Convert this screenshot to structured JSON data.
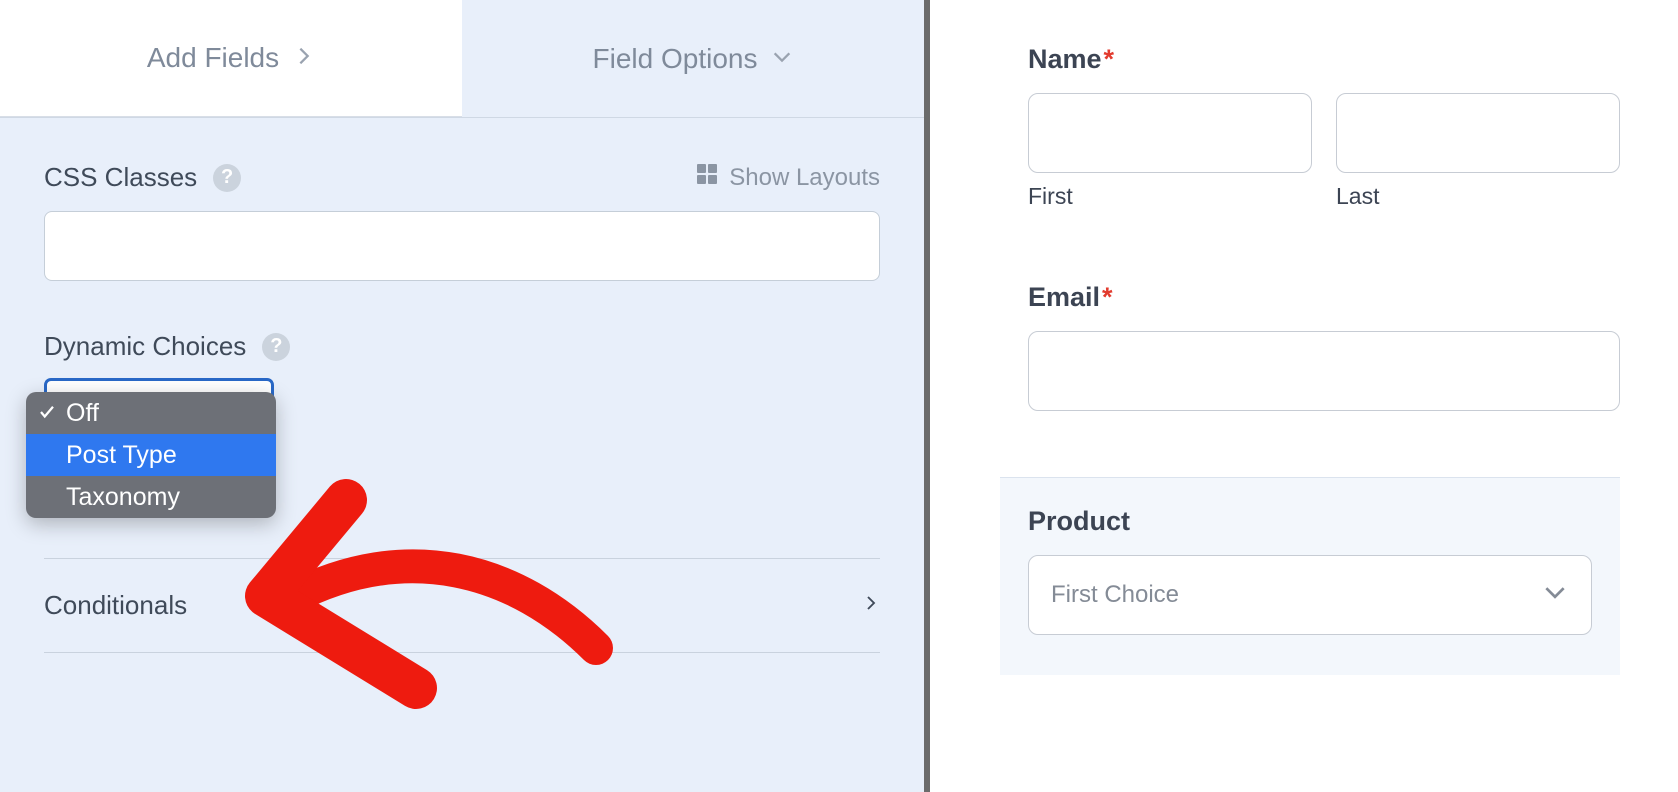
{
  "tabs": {
    "add_fields": "Add Fields",
    "field_options": "Field Options"
  },
  "left": {
    "css_classes_label": "CSS Classes",
    "show_layouts": "Show Layouts",
    "css_classes_value": "",
    "dynamic_choices_label": "Dynamic Choices",
    "dynamic_options": [
      "Off",
      "Post Type",
      "Taxonomy"
    ],
    "dynamic_selected": "Off",
    "dynamic_highlighted": "Post Type",
    "conditionals_label": "Conditionals"
  },
  "preview": {
    "name_label": "Name",
    "first_label": "First",
    "last_label": "Last",
    "email_label": "Email",
    "product_label": "Product",
    "product_value": "First Choice"
  }
}
